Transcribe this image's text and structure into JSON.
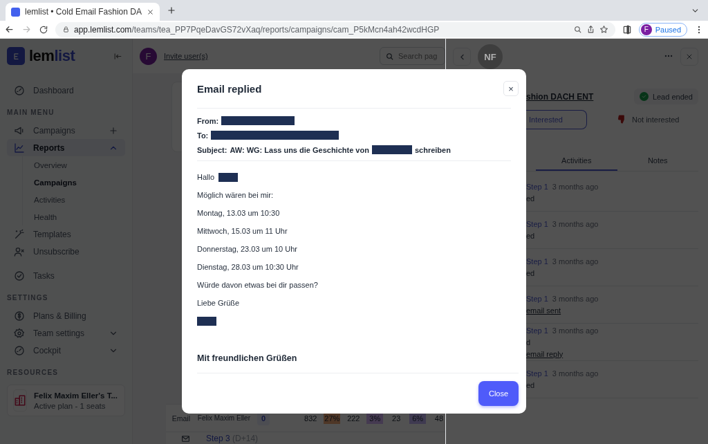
{
  "browser": {
    "tab_title": "lemlist • Cold Email Fashion DA",
    "url_host": "app.lemlist.com",
    "url_path": "/teams/tea_PP7PqeDavGS72vXaq/reports/campaigns/cam_P5kMcn4ah42wcdHGP",
    "profile_initial": "F",
    "profile_status": "Paused"
  },
  "sidebar": {
    "logo_prefix": "lem",
    "logo_suffix": "list",
    "sections": [
      {
        "items": [
          {
            "label": "Dashboard",
            "selected": false
          }
        ]
      },
      {
        "heading": "MAIN MENU",
        "items": [
          {
            "label": "Campaigns",
            "selected": false
          },
          {
            "label": "Reports",
            "selected": true,
            "expanded": true,
            "children": [
              {
                "label": "Overview",
                "selected": false
              },
              {
                "label": "Campaigns",
                "selected": true
              },
              {
                "label": "Activities",
                "selected": false
              },
              {
                "label": "Health",
                "selected": false
              }
            ]
          },
          {
            "label": "Templates",
            "selected": false
          },
          {
            "label": "Unsubscribe",
            "selected": false
          },
          {
            "label": "Tasks",
            "selected": false
          }
        ]
      },
      {
        "heading": "SETTINGS",
        "items": [
          {
            "label": "Plans & Billing",
            "selected": false
          },
          {
            "label": "Team settings",
            "selected": false,
            "expanded": false
          },
          {
            "label": "Cockpit",
            "selected": false,
            "expanded": false
          }
        ]
      },
      {
        "heading": "RESOURCES"
      }
    ],
    "workspace": {
      "name": "Felix Maxim Eller's T...",
      "plan": "Active plan - 1 seats"
    }
  },
  "header": {
    "avatar_initial": "F",
    "invite_link": "Invite user(s)",
    "search_placeholder": "Search pag"
  },
  "table": {
    "rows": [
      {
        "type": "Email",
        "owner": "Felix Maxim Eller",
        "badge": "0",
        "values": [
          "832",
          "27%",
          "222",
          "3%",
          "23",
          "6%",
          "48"
        ]
      },
      {
        "step": "Step 3",
        "delay": "(D+14)"
      }
    ]
  },
  "lead_panel": {
    "avatar_initials": "NF",
    "campaign": "shion DACH ENT",
    "status": "Lead ended",
    "interested": "Interested",
    "not_interested": "Not interested",
    "tabs": [
      {
        "label": "Activities",
        "selected": true
      },
      {
        "label": "Notes",
        "selected": false
      }
    ],
    "activities": [
      {
        "step": "Step 1",
        "time": "3 months ago",
        "status": "ed"
      },
      {
        "step": "Step 1",
        "time": "3 months ago",
        "status": "ed"
      },
      {
        "step": "Step 1",
        "time": "3 months ago",
        "status": "ed"
      },
      {
        "step": "Step 1",
        "time": "3 months ago",
        "link": "email sent"
      },
      {
        "step": "Step 1",
        "time": "3 months ago",
        "status": "d",
        "link": "email reply"
      },
      {
        "step": "Step 1",
        "time": "3 months ago",
        "status": "ed"
      }
    ]
  },
  "modal": {
    "title": "Email replied",
    "close_icon": "×",
    "fields": [
      {
        "label": "From:",
        "parts": [
          {
            "kind": "redaction"
          }
        ]
      },
      {
        "label": "To:",
        "parts": [
          {
            "kind": "redaction"
          }
        ]
      },
      {
        "label": "Subject:",
        "parts": [
          {
            "kind": "text",
            "text": "AW: WG: Lass uns die Geschichte von"
          },
          {
            "kind": "redaction"
          },
          {
            "kind": "text",
            "text": "schreiben"
          }
        ]
      }
    ],
    "body": [
      {
        "kind": "line",
        "parts": [
          {
            "kind": "text",
            "text": "Hallo"
          },
          {
            "kind": "redaction"
          }
        ]
      },
      {
        "kind": "line",
        "parts": [
          {
            "kind": "text",
            "text": "Möglich wären bei mir:"
          }
        ]
      },
      {
        "kind": "line",
        "parts": [
          {
            "kind": "text",
            "text": "Montag, 13.03 um 10:30"
          }
        ]
      },
      {
        "kind": "line",
        "parts": [
          {
            "kind": "text",
            "text": "Mittwoch, 15.03 um 11 Uhr"
          }
        ]
      },
      {
        "kind": "line",
        "parts": [
          {
            "kind": "text",
            "text": "Donnerstag, 23.03 um 10 Uhr"
          }
        ]
      },
      {
        "kind": "line",
        "parts": [
          {
            "kind": "text",
            "text": "Dienstag, 28.03 um 10:30 Uhr"
          }
        ]
      },
      {
        "kind": "line",
        "parts": [
          {
            "kind": "text",
            "text": "Würde davon etwas bei dir passen?"
          }
        ]
      },
      {
        "kind": "line",
        "parts": [
          {
            "kind": "text",
            "text": "Liebe Grüße"
          }
        ]
      },
      {
        "kind": "line",
        "parts": [
          {
            "kind": "redaction"
          }
        ]
      },
      {
        "kind": "heading",
        "parts": [
          {
            "kind": "text",
            "text": "Mit freundlichen Grüßen"
          }
        ]
      }
    ],
    "close_button": "Close"
  }
}
